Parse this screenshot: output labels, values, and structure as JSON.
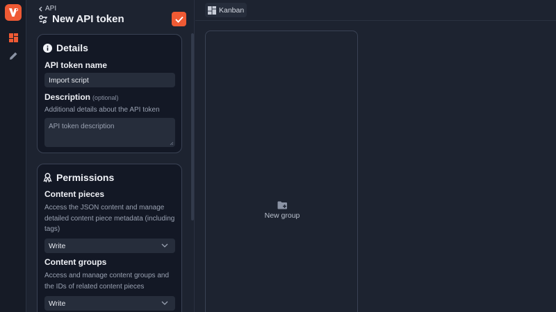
{
  "rail": {
    "logo_letter": "V",
    "items": [
      {
        "icon": "dashboard-icon"
      },
      {
        "icon": "pencil-icon"
      }
    ]
  },
  "panel": {
    "back_label": "API",
    "title": "New API token",
    "title_icon": "api-token-icon",
    "save_icon": "checkmark-icon"
  },
  "details": {
    "heading": "Details",
    "name_label": "API token name",
    "name_value": "Import script",
    "description_label": "Description",
    "description_optional": "(optional)",
    "description_help": "Additional details about the API token",
    "description_placeholder": "API token description"
  },
  "permissions": {
    "heading": "Permissions",
    "groups": [
      {
        "label": "Content pieces",
        "help": "Access the JSON content and manage detailed content piece metadata (including tags)",
        "value": "Write"
      },
      {
        "label": "Content groups",
        "help": "Access and manage content groups and the IDs of related content pieces",
        "value": "Write"
      }
    ]
  },
  "main": {
    "view_label": "Kanban",
    "new_group_label": "New group"
  },
  "colors": {
    "accent": "#ef5a34",
    "background": "#1d2330",
    "card": "#131825",
    "input": "#262d3b"
  }
}
